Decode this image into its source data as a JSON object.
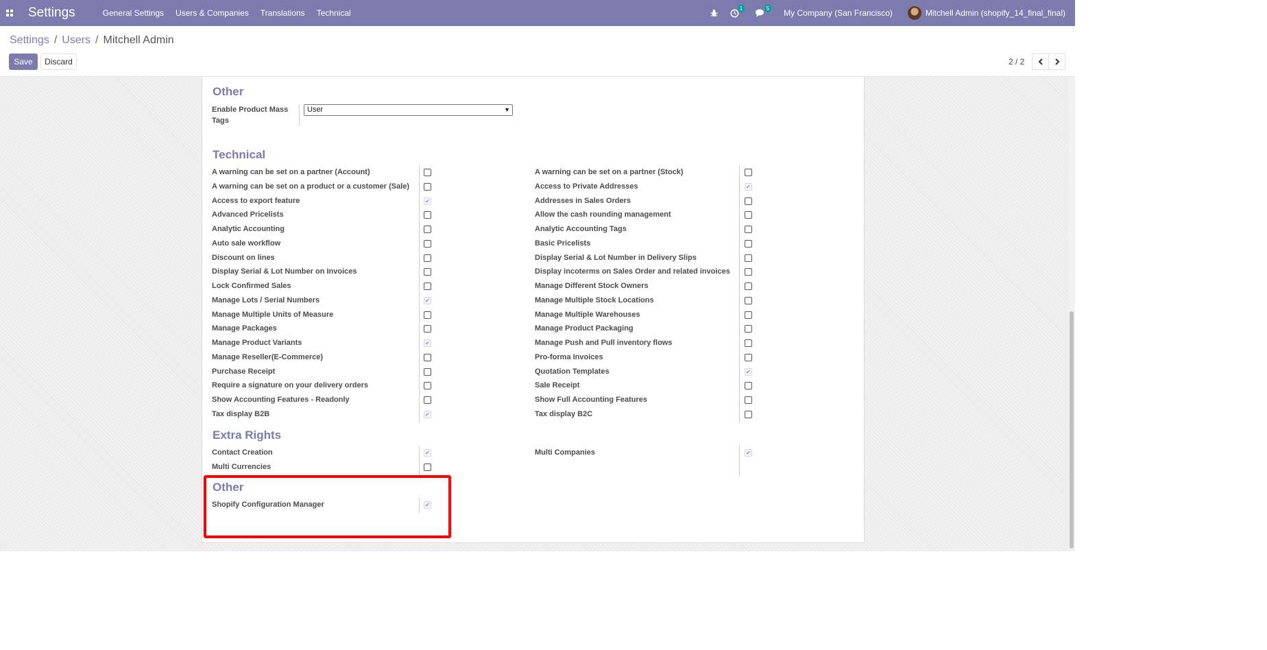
{
  "navbar": {
    "title": "Settings",
    "menu": [
      "General Settings",
      "Users & Companies",
      "Translations",
      "Technical"
    ],
    "activity_badge": "1",
    "messages_badge": "5",
    "company": "My Company (San Francisco)",
    "user": "Mitchell Admin (shopify_14_final_final)"
  },
  "breadcrumb": [
    "Settings",
    "Users",
    "Mitchell Admin"
  ],
  "buttons": {
    "save": "Save",
    "discard": "Discard"
  },
  "pager": "2 / 2",
  "sections": {
    "other_top": {
      "title": "Other",
      "field_label": "Enable Product Mass Tags",
      "field_value": "User"
    },
    "technical": {
      "title": "Technical",
      "left": [
        {
          "label": "A warning can be set on a partner (Account)",
          "checked": false
        },
        {
          "label": "A warning can be set on a product or a customer (Sale)",
          "checked": false
        },
        {
          "label": "Access to export feature",
          "checked": true
        },
        {
          "label": "Advanced Pricelists",
          "checked": false
        },
        {
          "label": "Analytic Accounting",
          "checked": false
        },
        {
          "label": "Auto sale workflow",
          "checked": false
        },
        {
          "label": "Discount on lines",
          "checked": false
        },
        {
          "label": "Display Serial & Lot Number on Invoices",
          "checked": false
        },
        {
          "label": "Lock Confirmed Sales",
          "checked": false
        },
        {
          "label": "Manage Lots / Serial Numbers",
          "checked": true
        },
        {
          "label": "Manage Multiple Units of Measure",
          "checked": false
        },
        {
          "label": "Manage Packages",
          "checked": false
        },
        {
          "label": "Manage Product Variants",
          "checked": true
        },
        {
          "label": "Manage Reseller(E-Commerce)",
          "checked": false
        },
        {
          "label": "Purchase Receipt",
          "checked": false
        },
        {
          "label": "Require a signature on your delivery orders",
          "checked": false
        },
        {
          "label": "Show Accounting Features - Readonly",
          "checked": false
        },
        {
          "label": "Tax display B2B",
          "checked": true
        }
      ],
      "right": [
        {
          "label": "A warning can be set on a partner (Stock)",
          "checked": false
        },
        {
          "label": "Access to Private Addresses",
          "checked": true
        },
        {
          "label": "Addresses in Sales Orders",
          "checked": false
        },
        {
          "label": "Allow the cash rounding management",
          "checked": false
        },
        {
          "label": "Analytic Accounting Tags",
          "checked": false
        },
        {
          "label": "Basic Pricelists",
          "checked": false
        },
        {
          "label": "Display Serial & Lot Number in Delivery Slips",
          "checked": false
        },
        {
          "label": "Display incoterms on Sales Order and related invoices",
          "checked": false
        },
        {
          "label": "Manage Different Stock Owners",
          "checked": false
        },
        {
          "label": "Manage Multiple Stock Locations",
          "checked": false
        },
        {
          "label": "Manage Multiple Warehouses",
          "checked": false
        },
        {
          "label": "Manage Product Packaging",
          "checked": false
        },
        {
          "label": "Manage Push and Pull inventory flows",
          "checked": false
        },
        {
          "label": "Pro-forma Invoices",
          "checked": false
        },
        {
          "label": "Quotation Templates",
          "checked": true
        },
        {
          "label": "Sale Receipt",
          "checked": false
        },
        {
          "label": "Show Full Accounting Features",
          "checked": false
        },
        {
          "label": "Tax display B2C",
          "checked": false
        }
      ]
    },
    "extra_rights": {
      "title": "Extra Rights",
      "left": [
        {
          "label": "Contact Creation",
          "checked": true
        },
        {
          "label": "Multi Currencies",
          "checked": false
        }
      ],
      "right": [
        {
          "label": "Multi Companies",
          "checked": true
        }
      ]
    },
    "other_bottom": {
      "title": "Other",
      "items": [
        {
          "label": "Shopify Configuration Manager",
          "checked": true
        }
      ]
    }
  },
  "colors": {
    "brand": "#7c7bad",
    "highlight": "#ff0000"
  }
}
